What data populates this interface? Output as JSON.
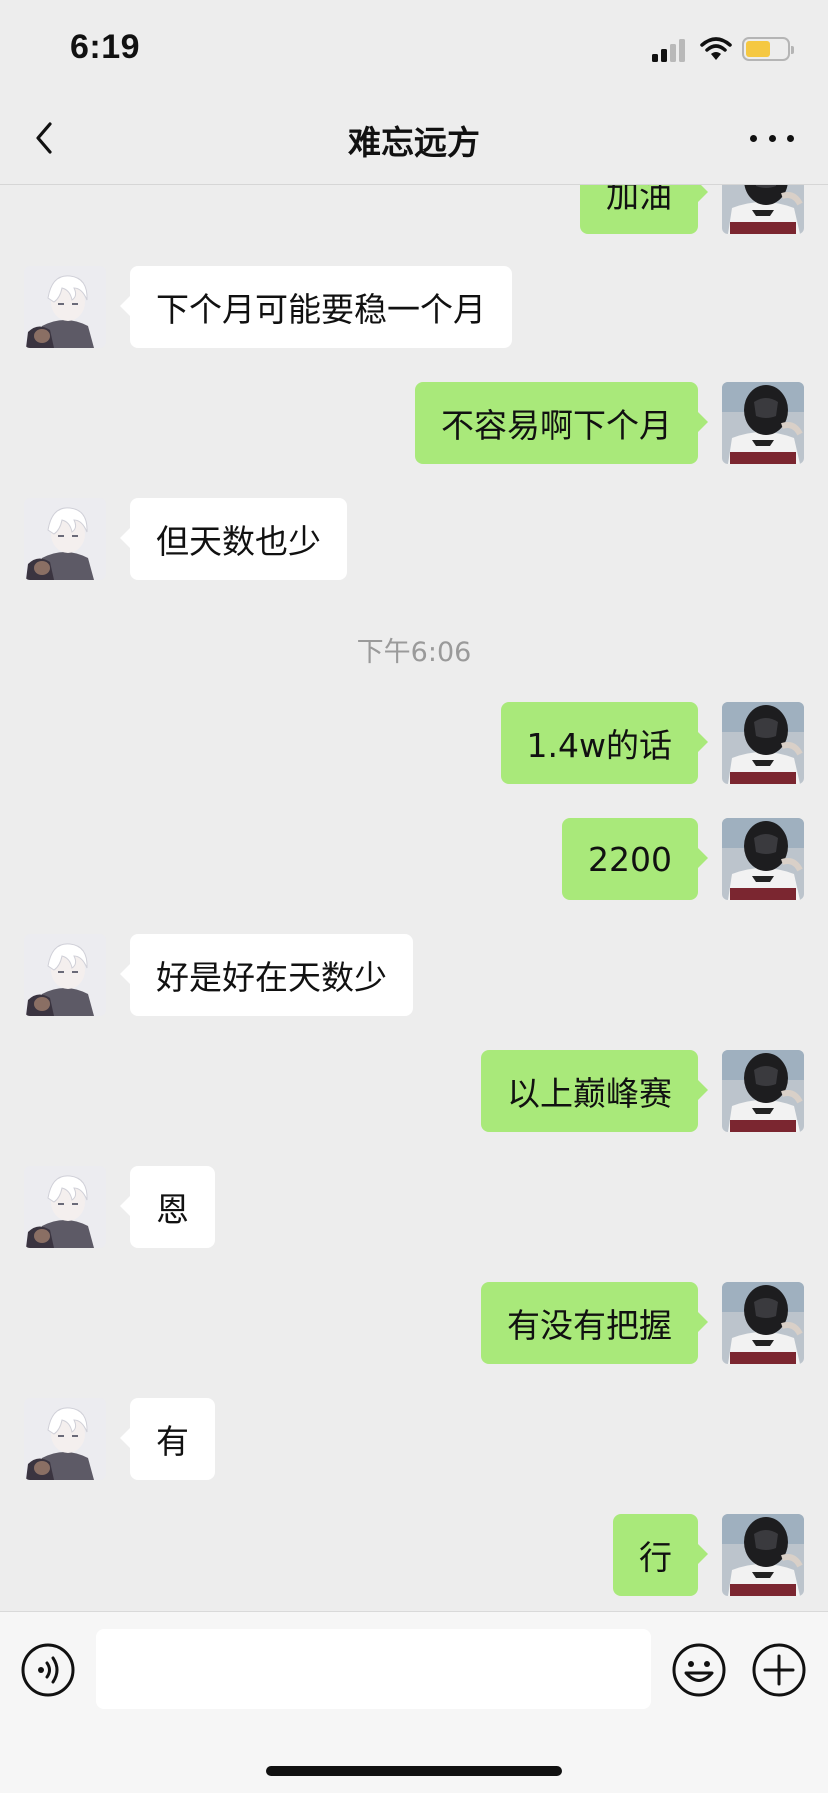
{
  "status_bar": {
    "time": "6:19",
    "battery_level": 0.6,
    "battery_color": "#f5c842"
  },
  "header": {
    "title": "难忘远方",
    "back_icon": "chevron-left-icon",
    "more_icon": "ellipsis-icon"
  },
  "colors": {
    "self_bubble": "#a9e97a",
    "other_bubble": "#ffffff",
    "background": "#ededed"
  },
  "messages": [
    {
      "from": "me",
      "text": "加油"
    },
    {
      "from": "other",
      "text": "下个月可能要稳一个月"
    },
    {
      "from": "me",
      "text": "不容易啊下个月"
    },
    {
      "from": "other",
      "text": "但天数也少"
    },
    {
      "type": "timestamp",
      "text": "下午6:06"
    },
    {
      "from": "me",
      "text": "1.4w的话"
    },
    {
      "from": "me",
      "text": "2200"
    },
    {
      "from": "other",
      "text": "好是好在天数少"
    },
    {
      "from": "me",
      "text": "以上巅峰赛"
    },
    {
      "from": "other",
      "text": "恩"
    },
    {
      "from": "me",
      "text": "有没有把握"
    },
    {
      "from": "other",
      "text": "有"
    },
    {
      "from": "me",
      "text": "行"
    }
  ],
  "input_bar": {
    "voice_icon": "voice-icon",
    "emoji_icon": "emoji-icon",
    "plus_icon": "plus-icon",
    "value": ""
  }
}
